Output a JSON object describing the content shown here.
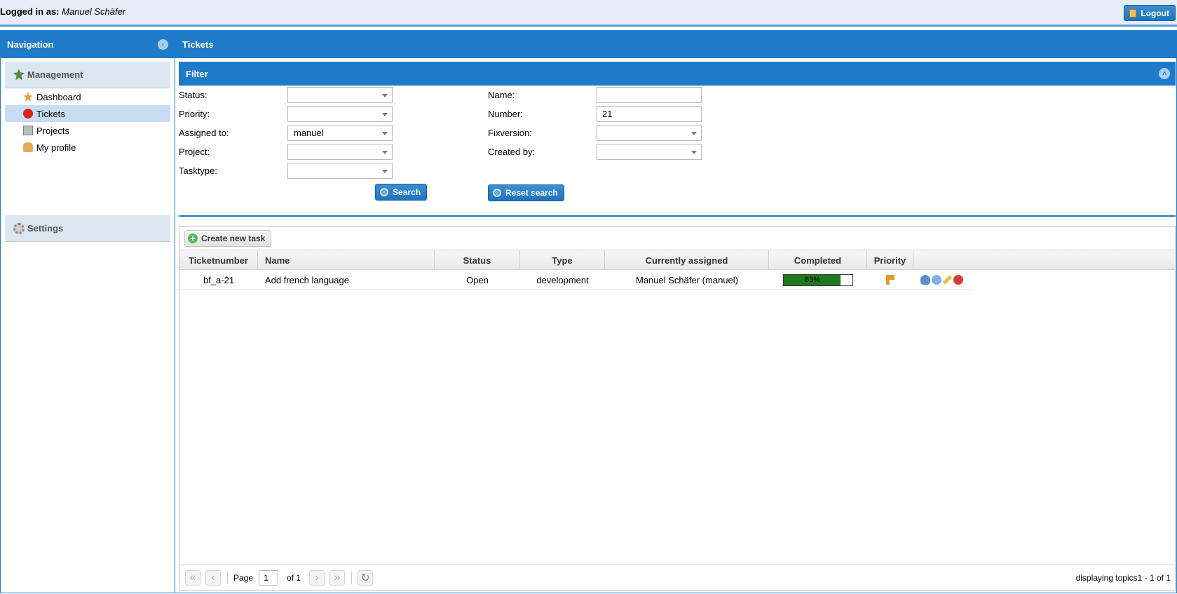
{
  "topbar": {
    "login_label": "Logged in as:",
    "user": "Manuel Schäfer",
    "logout": "Logout"
  },
  "nav": {
    "title": "Navigation",
    "sections": [
      {
        "label": "Management",
        "items": [
          {
            "label": "Dashboard",
            "icon": "dashboard-icon"
          },
          {
            "label": "Tickets",
            "icon": "ticket-icon",
            "active": true
          },
          {
            "label": "Projects",
            "icon": "projects-icon"
          },
          {
            "label": "My profile",
            "icon": "profile-icon"
          }
        ]
      },
      {
        "label": "Settings",
        "items": []
      }
    ]
  },
  "main": {
    "title": "Tickets"
  },
  "filter": {
    "title": "Filter",
    "status_label": "Status:",
    "status_value": "",
    "priority_label": "Priority:",
    "priority_value": "",
    "assigned_label": "Assigned to:",
    "assigned_value": "manuel",
    "project_label": "Project:",
    "project_value": "",
    "tasktype_label": "Tasktype:",
    "tasktype_value": "",
    "name_label": "Name:",
    "name_value": "",
    "number_label": "Number:",
    "number_value": "21",
    "fixversion_label": "Fixversion:",
    "fixversion_value": "",
    "createdby_label": "Created by:",
    "createdby_value": "",
    "search": "Search",
    "reset": "Reset search"
  },
  "grid": {
    "create_button": "Create new task",
    "columns": [
      "Ticketnumber",
      "Name",
      "Status",
      "Type",
      "Currently assigned",
      "Completed",
      "Priority",
      ""
    ],
    "rows": [
      {
        "ticketnumber": "bf_a-21",
        "name": "Add french language",
        "status": "Open",
        "type": "development",
        "assigned": "Manuel Schäfer (manuel)",
        "completed": "83%",
        "completed_fraction": 0.83
      }
    ],
    "pager": {
      "page_label": "Page",
      "page": "1",
      "of": "of 1",
      "info": "displaying topics1 - 1 of 1"
    }
  },
  "colors": {
    "header_blue": "#1f7bca",
    "progress_green": "#1f7a1f",
    "active_nav": "#c7ddf1"
  }
}
